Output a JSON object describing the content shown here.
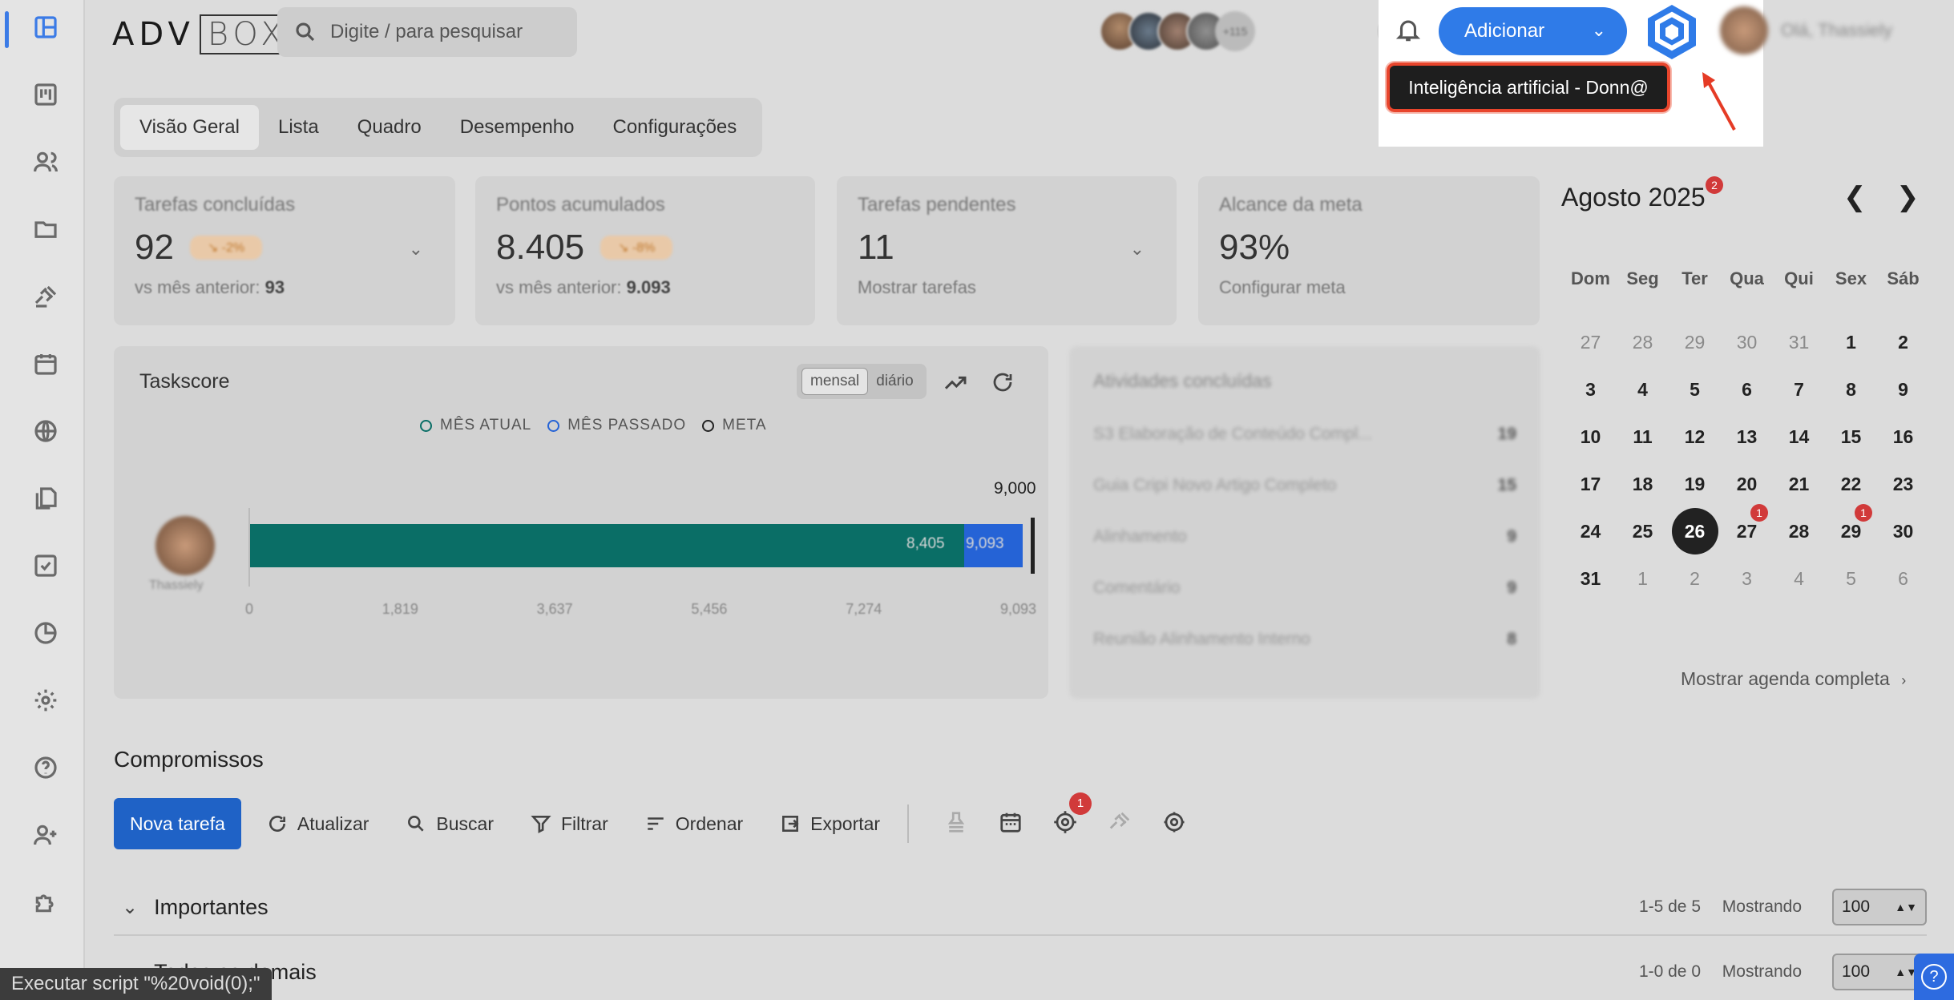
{
  "logo": {
    "left": "ADV",
    "right": "BOX"
  },
  "search": {
    "placeholder": "Digite / para pesquisar"
  },
  "header": {
    "avatars_more": "+115",
    "add_button": "Adicionar",
    "tooltip": "Inteligência artificial - Donn@",
    "user_name": "Olá, Thassiely"
  },
  "tabs": [
    "Visão Geral",
    "Lista",
    "Quadro",
    "Desempenho",
    "Configurações"
  ],
  "cards": [
    {
      "title": "Tarefas concluídas",
      "value": "92",
      "badge": "↘ -2%",
      "sub_label": "vs mês anterior:",
      "sub_value": "93"
    },
    {
      "title": "Pontos acumulados",
      "value": "8.405",
      "badge": "↘ -8%",
      "sub_label": "vs mês anterior:",
      "sub_value": "9.093"
    },
    {
      "title": "Tarefas pendentes",
      "value": "11",
      "sub_label": "Mostrar tarefas"
    },
    {
      "title": "Alcance da meta",
      "value": "93%",
      "sub_label": "Configurar meta"
    }
  ],
  "taskscore": {
    "title": "Taskscore",
    "toggle": [
      "mensal",
      "diário"
    ],
    "legend": [
      {
        "label": "MÊS ATUAL",
        "color": "#0a6e66"
      },
      {
        "label": "MÊS PASSADO",
        "color": "#2563d6"
      },
      {
        "label": "META",
        "color": "#222222"
      }
    ],
    "goal_label": "9,000",
    "user_label": "Thassiely"
  },
  "chart_data": {
    "type": "bar",
    "orientation": "horizontal",
    "categories": [
      "Thassiely"
    ],
    "series": [
      {
        "name": "MÊS ATUAL",
        "values": [
          8405
        ],
        "labels": [
          "8,405"
        ]
      },
      {
        "name": "MÊS PASSADO",
        "values": [
          9093
        ],
        "labels": [
          "9,093"
        ]
      }
    ],
    "goal": 9000,
    "xlim": [
      0,
      9093
    ],
    "ticks": [
      "0",
      "1,819",
      "3,637",
      "5,456",
      "7,274",
      "9,093"
    ]
  },
  "activities": {
    "title": "Atividades concluídas",
    "rows": [
      {
        "label": "S3 Elaboração de Conteúdo Compl...",
        "count": "19"
      },
      {
        "label": "Guia Cripi Novo Artigo Completo",
        "count": "15"
      },
      {
        "label": "Alinhamento",
        "count": "9"
      },
      {
        "label": "Comentário",
        "count": "9"
      },
      {
        "label": "Reunião Alinhamento Interno",
        "count": "8"
      }
    ]
  },
  "calendar": {
    "title": "Agosto 2025",
    "badge": "2",
    "prev": "❮",
    "next": "❯",
    "weekdays": [
      "Dom",
      "Seg",
      "Ter",
      "Qua",
      "Qui",
      "Sex",
      "Sáb"
    ],
    "weeks": [
      [
        "27",
        "28",
        "29",
        "30",
        "31",
        "1",
        "2"
      ],
      [
        "3",
        "4",
        "5",
        "6",
        "7",
        "8",
        "9"
      ],
      [
        "10",
        "11",
        "12",
        "13",
        "14",
        "15",
        "16"
      ],
      [
        "17",
        "18",
        "19",
        "20",
        "21",
        "22",
        "23"
      ],
      [
        "24",
        "25",
        "26",
        "27",
        "28",
        "29",
        "30"
      ],
      [
        "31",
        "1",
        "2",
        "3",
        "4",
        "5",
        "6"
      ]
    ],
    "events": {
      "27": "1",
      "29": "1"
    },
    "today": "26",
    "link": "Mostrar agenda completa"
  },
  "compromissos": {
    "title": "Compromissos",
    "nova": "Nova tarefa",
    "buttons": [
      "Atualizar",
      "Buscar",
      "Filtrar",
      "Ordenar",
      "Exportar"
    ],
    "icon_badge": "1",
    "sections": [
      {
        "title": "Importantes",
        "count": "1-5 de 5",
        "showing": "Mostrando",
        "per_page": "100"
      },
      {
        "title": "Todas as demais",
        "count": "1-0 de 0",
        "showing": "Mostrando",
        "per_page": "100"
      }
    ]
  },
  "statusbar": "Executar script \"%20void(0);\""
}
